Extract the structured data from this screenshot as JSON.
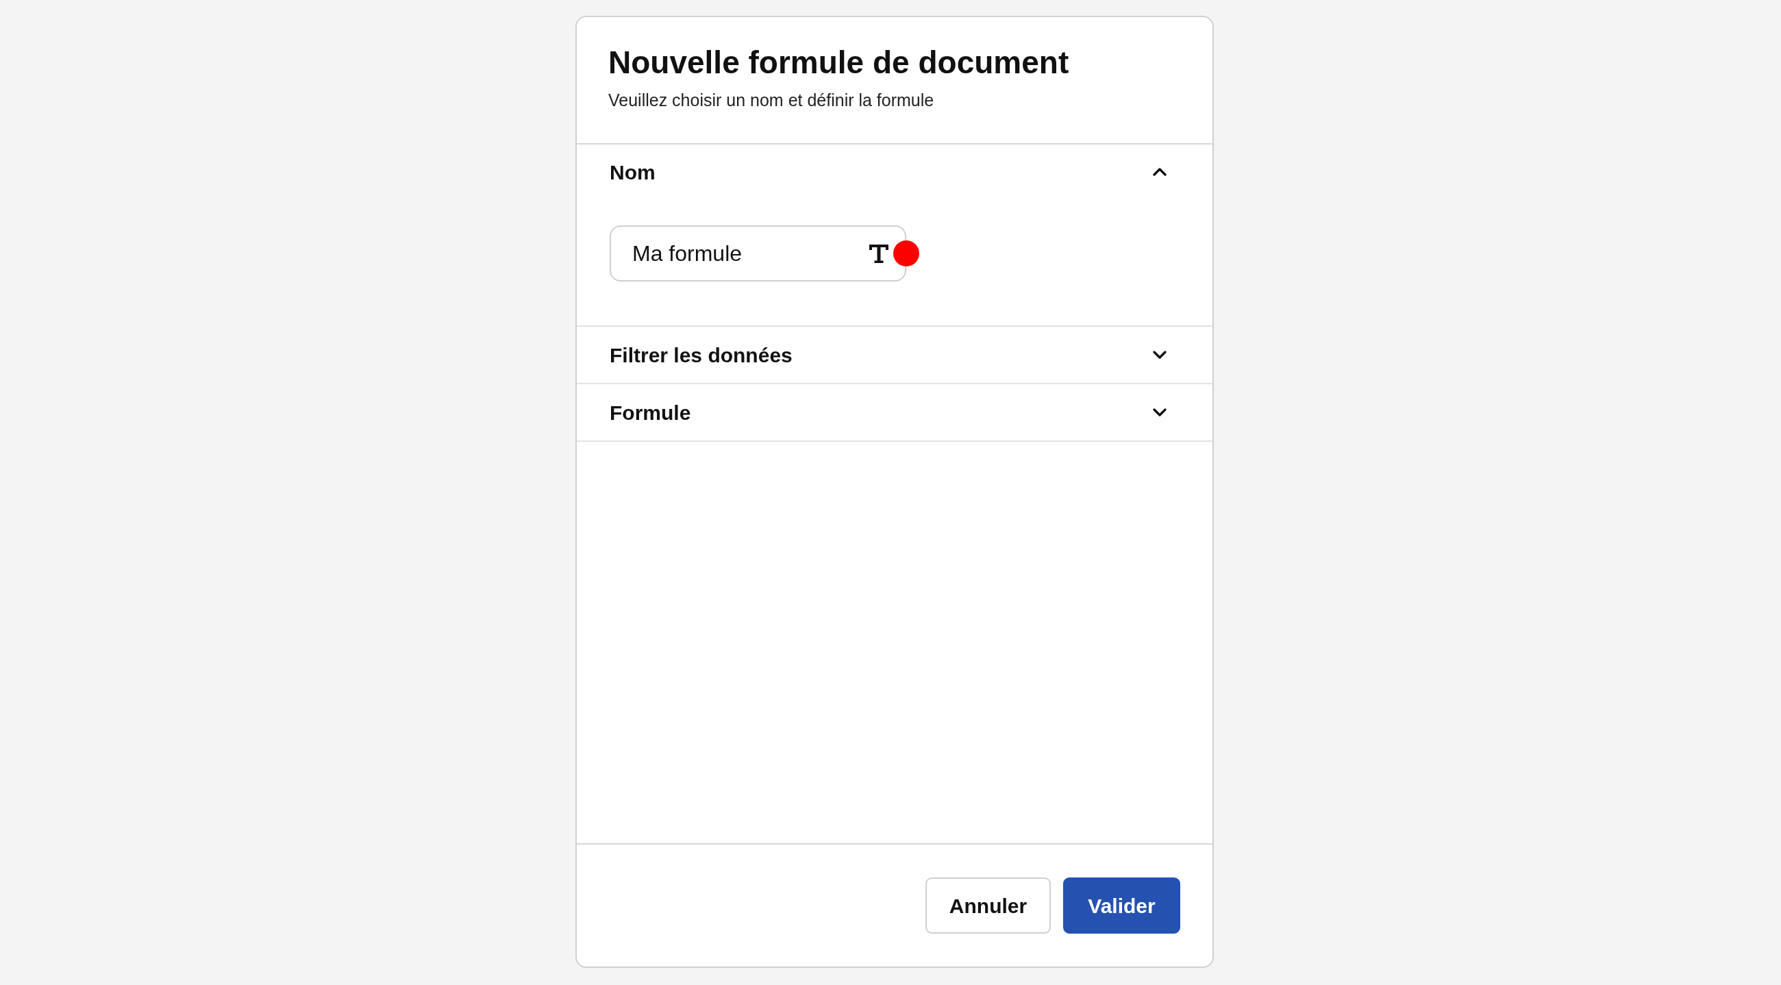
{
  "dialog": {
    "title": "Nouvelle formule de document",
    "subtitle": "Veuillez choisir un nom et définir la formule"
  },
  "sections": [
    {
      "label": "Nom",
      "expanded": true,
      "field": {
        "value": "Ma formule",
        "invalid": true
      }
    },
    {
      "label": "Filtrer les données",
      "expanded": false
    },
    {
      "label": "Formule",
      "expanded": false
    }
  ],
  "buttons": [
    {
      "label": "Annuler",
      "kind": "secondary"
    },
    {
      "label": "Valider",
      "kind": "primary"
    }
  ]
}
